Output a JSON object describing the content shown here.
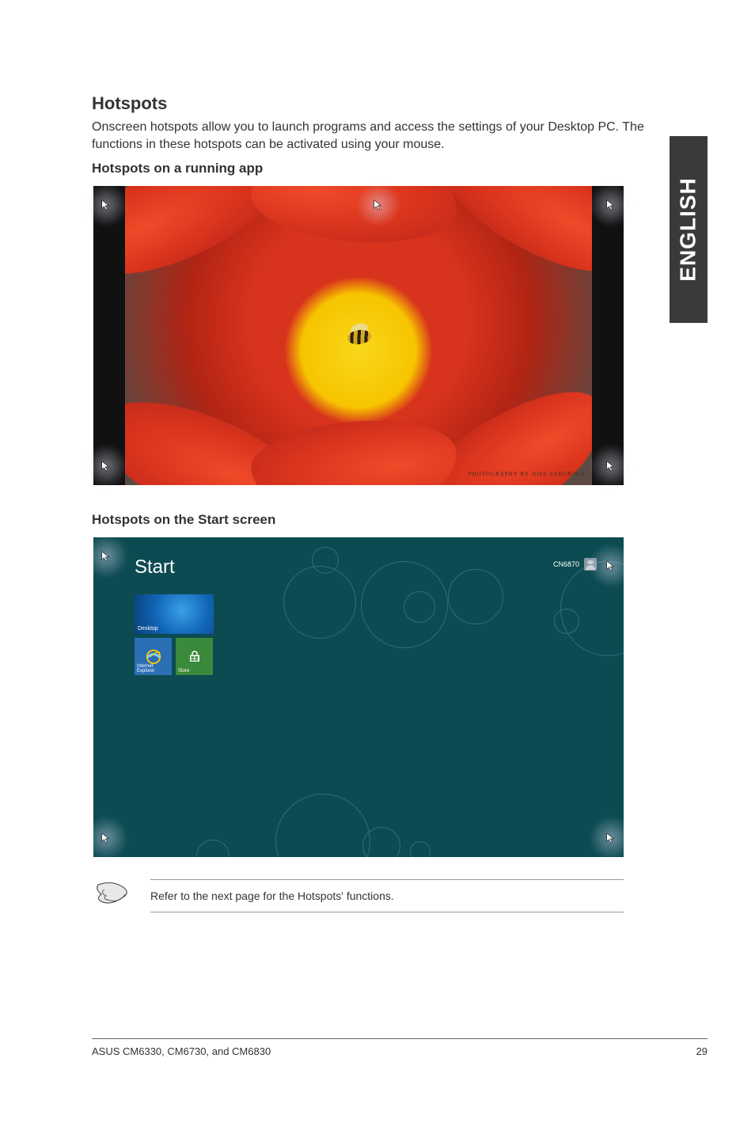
{
  "headings": {
    "title": "Hotspots",
    "intro": "Onscreen hotspots allow you to launch programs and access the settings of your Desktop PC. The functions in these hotspots can be activated using your mouse.",
    "sub1": "Hotspots on a running app",
    "sub2": "Hotspots on the Start screen"
  },
  "running_app_screenshot": {
    "photo_credit": "PHOTOGRAPHY BY JOSE SABUROLA"
  },
  "start_screen": {
    "title": "Start",
    "user": "CN6870",
    "tiles": {
      "desktop": "Desktop",
      "ie": "Internet Explorer",
      "store": "Store"
    }
  },
  "note": "Refer to the next page for the Hotspots' functions.",
  "side_tab": "ENGLISH",
  "footer": {
    "left": "ASUS CM6330, CM6730, and CM6830",
    "right": "29"
  }
}
